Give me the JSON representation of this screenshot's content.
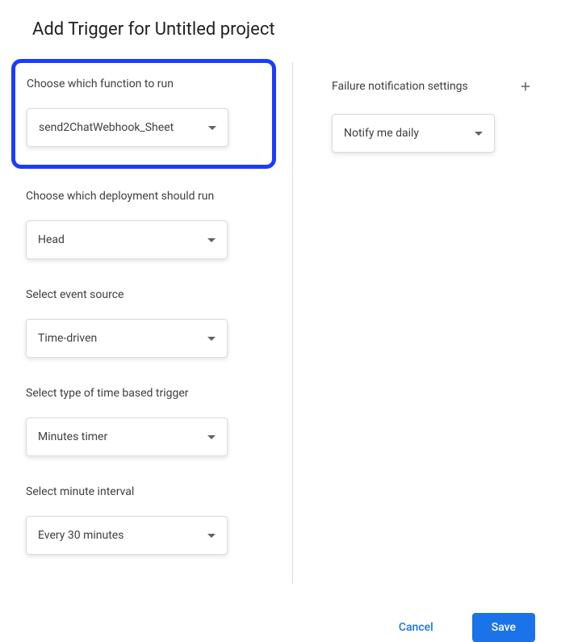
{
  "title": "Add Trigger for Untitled project",
  "leftColumn": {
    "functionToRun": {
      "label": "Choose which function to run",
      "value": "send2ChatWebhook_Sheet"
    },
    "deployment": {
      "label": "Choose which deployment should run",
      "value": "Head"
    },
    "eventSource": {
      "label": "Select event source",
      "value": "Time-driven"
    },
    "triggerType": {
      "label": "Select type of time based trigger",
      "value": "Minutes timer"
    },
    "minuteInterval": {
      "label": "Select minute interval",
      "value": "Every 30 minutes"
    }
  },
  "rightColumn": {
    "failureNotification": {
      "label": "Failure notification settings",
      "value": "Notify me daily"
    }
  },
  "footer": {
    "cancel": "Cancel",
    "save": "Save"
  }
}
